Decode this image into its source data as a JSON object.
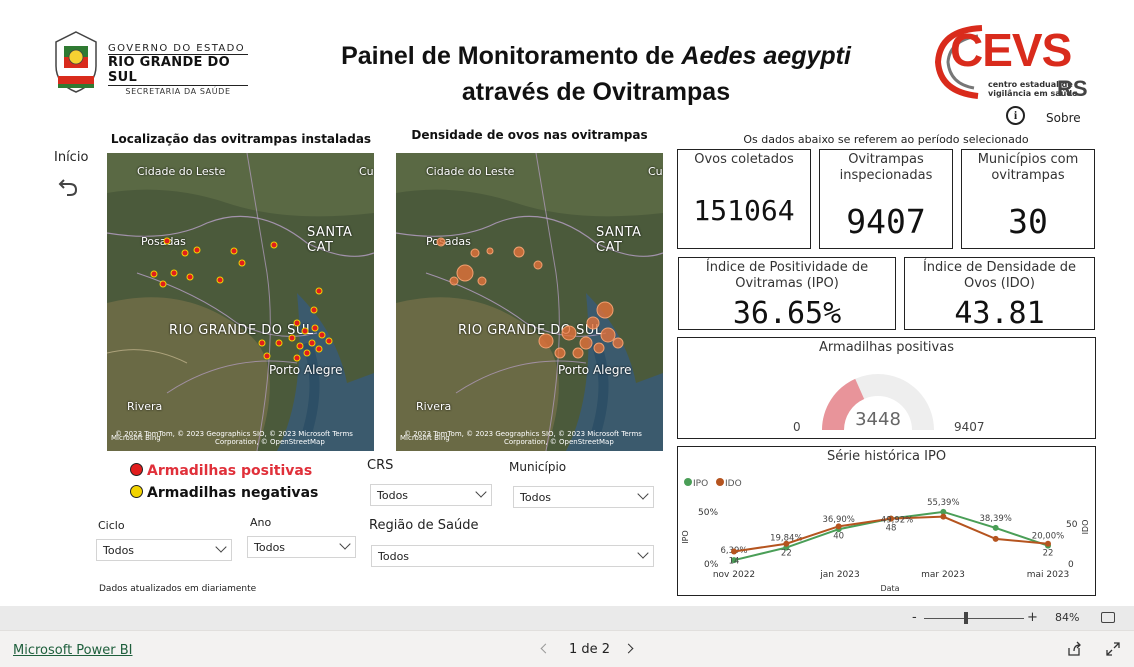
{
  "header": {
    "gov_line1": "GOVERNO DO ESTADO",
    "gov_line2": "RIO GRANDE DO SUL",
    "gov_line3": "SECRETARIA DA SAÚDE",
    "title_part1": "Painel de Monitoramento de ",
    "title_italic": "Aedes aegypti",
    "title_line2": "através de Ovitrampas",
    "cevs_logo": "CEVS",
    "cevs_sub1": "centro estadual de",
    "cevs_sub2": "vigilância em saúde",
    "cevs_rs": "RS",
    "about_label": "Sobre",
    "about_icon": "info-icon"
  },
  "nav": {
    "home_label": "Início",
    "back_icon": "back-arrow-icon"
  },
  "maps": {
    "map1_title": "Localização das ovitrampas instaladas",
    "map2_title": "Densidade de ovos nas ovitrampas",
    "labels": {
      "cidade_leste": "Cidade do Leste",
      "posadas": "Posadas",
      "santa_cat": "SANTA CAT",
      "rgs": "RIO GRANDE DO SUL",
      "porto_alegre": "Porto Alegre",
      "rivera": "Rivera",
      "cu": "Cu"
    },
    "attribution_line1": "© 2023 TomTom, © 2023 Geographics SIO, © 2023 Microsoft  Terms",
    "attribution_line2": "Corporation, © OpenStreetMap",
    "bing_label": "Microsoft Bing"
  },
  "legend": {
    "positive_label": "Armadilhas positivas",
    "negative_label": "Armadilhas negativas",
    "positive_color": "#e11d1d",
    "negative_color": "#f2d300"
  },
  "filters": {
    "crs_title": "CRS",
    "crs_value": "Todos",
    "municipio_title": "Município",
    "municipio_value": "Todos",
    "ciclo_title": "Ciclo",
    "ciclo_value": "Todos",
    "ano_title": "Ano",
    "ano_value": "Todos",
    "regiao_title": "Região de Saúde",
    "regiao_value": "Todos",
    "updated_note": "Dados atualizados em diariamente"
  },
  "kpis": {
    "period_note": "Os dados abaixo se referem ao período selecionado",
    "ovos_label": "Ovos coletados",
    "ovos_value": "151064",
    "ovitrampas_label_1": "Ovitrampas",
    "ovitrampas_label_2": "inspecionadas",
    "ovitrampas_value": "9407",
    "municipios_label_1": "Municípios com",
    "municipios_label_2": "ovitrampas",
    "municipios_value": "30",
    "ipo_label_1": "Índice de Positividade de",
    "ipo_label_2": "Ovitramas (IPO)",
    "ipo_value": "36.65%",
    "ido_label_1": "Índice de Densidade de",
    "ido_label_2": "Ovos (IDO)",
    "ido_value": "43.81"
  },
  "gauge": {
    "title": "Armadilhas positivas",
    "min_label": "0",
    "max_label": "9407",
    "value_label": "3448",
    "value": 3448,
    "max": 9407,
    "fill_color": "#e8949a",
    "track_color": "#eeeeee"
  },
  "series_chart": {
    "title": "Série histórica IPO"
  },
  "chart_data": {
    "type": "line",
    "title": "Série histórica IPO",
    "xlabel": "Data",
    "ylabel_left": "IPO",
    "ylabel_right": "IDO",
    "x_ticks": [
      "nov 2022",
      "jan 2023",
      "mar 2023",
      "mai 2023"
    ],
    "y_left_ticks": [
      "0%",
      "50%"
    ],
    "y_right_ticks": [
      "0",
      "50"
    ],
    "series": [
      {
        "name": "IPO",
        "color": "#4a9e57",
        "values": [
          5,
          18,
          37,
          48,
          55,
          38.39,
          20
        ],
        "labels": [
          "6,39%",
          "19,84%",
          "36,90%",
          "",
          "55,39%",
          "38,39%",
          "20,00%"
        ]
      },
      {
        "name": "IDO",
        "color": "#b5541f",
        "values": [
          14,
          22,
          40,
          48,
          50,
          27,
          22
        ],
        "labels": [
          "14",
          "22",
          "40",
          "48",
          "",
          "",
          "22"
        ]
      }
    ],
    "extra_labels": [
      "49,92%"
    ]
  },
  "bottom": {
    "zoom_minus": "-",
    "zoom_plus": "+",
    "zoom_value": "84%",
    "zoom_level": 0.42,
    "powerbi_link": "Microsoft Power BI",
    "page_indicator": "1 de 2"
  }
}
